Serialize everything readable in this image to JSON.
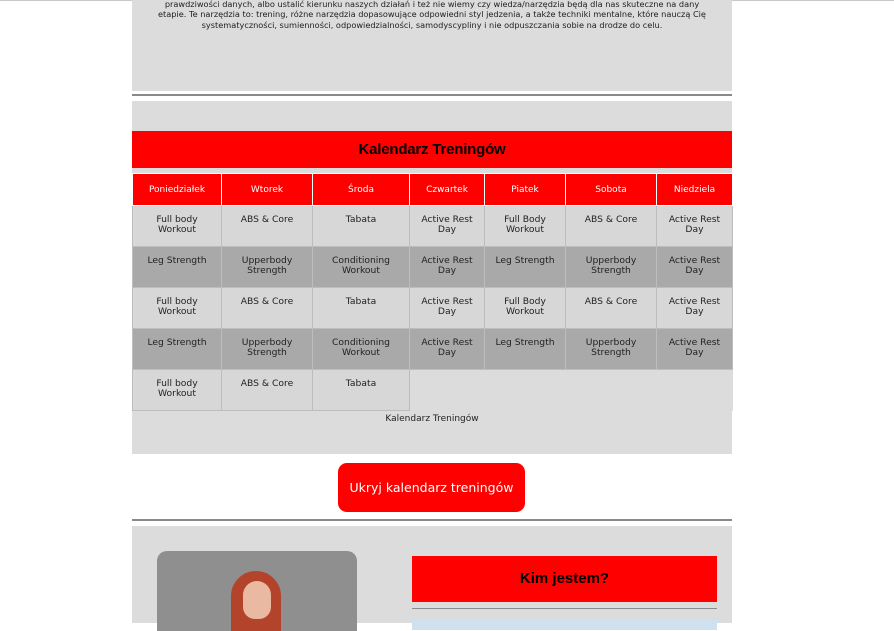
{
  "intro": {
    "text": "prawdziwości danych, albo ustalić kierunku naszych działań i też nie wiemy czy wiedza/narzędzia będą dla nas skuteczne na dany etapie. Te narzędzia to: trening, różne narzędzia dopasowujące odpowiedni styl jedzenia, a także techniki mentalne, które nauczą Cię systematyczności, sumienności, odpowiedzialności, samodyscypliny i nie odpuszczania sobie na drodze do celu."
  },
  "calendar": {
    "title": "Kalendarz Treningów",
    "days": [
      "Poniedziałek",
      "Wtorek",
      "Środa",
      "Czwartek",
      "Piatek",
      "Sobota",
      "Niedziela"
    ],
    "rows": [
      [
        "Full body Workout",
        "ABS & Core",
        "Tabata",
        "Active Rest Day",
        "Full Body Workout",
        "ABS & Core",
        "Active Rest Day"
      ],
      [
        "Leg Strength",
        "Upperbody Strength",
        "Conditioning Workout",
        "Active Rest Day",
        "Leg Strength",
        "Upperbody Strength",
        "Active Rest Day"
      ],
      [
        "Full body Workout",
        "ABS & Core",
        "Tabata",
        "Active Rest Day",
        "Full Body Workout",
        "ABS & Core",
        "Active Rest Day"
      ],
      [
        "Leg Strength",
        "Upperbody Strength",
        "Conditioning Workout",
        "Active Rest Day",
        "Leg Strength",
        "Upperbody Strength",
        "Active Rest Day"
      ],
      [
        "Full body Workout",
        "ABS & Core",
        "Tabata"
      ]
    ],
    "caption": "Kalendarz Treningów"
  },
  "toggle_button": {
    "label": "Ukryj kalendarz treningów"
  },
  "about": {
    "title": "Kim jestem?"
  },
  "colors": {
    "accent": "#ff0000",
    "panel": "#dcdcdc",
    "row_light": "#d7d7d7",
    "row_dark": "#a9a9a9"
  }
}
